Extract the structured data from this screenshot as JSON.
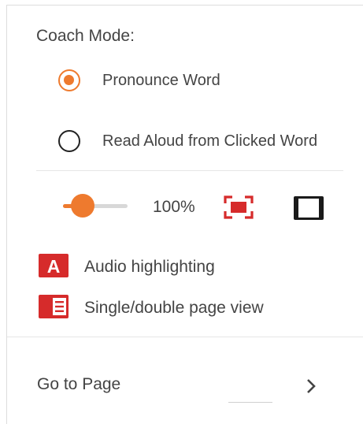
{
  "coach_mode": {
    "title": "Coach Mode:",
    "options": [
      {
        "label": "Pronounce Word",
        "selected": true
      },
      {
        "label": "Read Aloud from Clicked Word",
        "selected": false
      }
    ]
  },
  "zoom": {
    "value_label": "100%",
    "slider_fraction": 0.3,
    "fit_width_icon": "fit-to-screen-icon",
    "full_page_icon": "fit-page-icon"
  },
  "features": [
    {
      "label": "Audio highlighting",
      "icon": "audio-highlighting-icon",
      "icon_letter": "A"
    },
    {
      "label": "Single/double page view",
      "icon": "page-view-icon"
    }
  ],
  "goto": {
    "label": "Go to Page",
    "input_value": "",
    "arrow_icon": "chevron-right-icon"
  },
  "colors": {
    "accent": "#ee7a2e",
    "brand_red": "#d62b2b",
    "text": "#444444"
  }
}
